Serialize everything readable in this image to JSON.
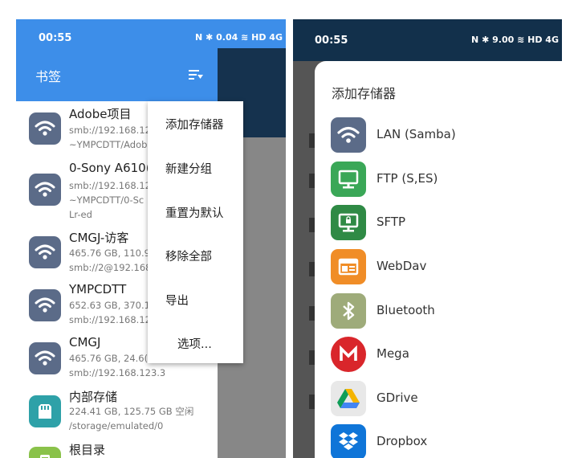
{
  "left": {
    "status": {
      "time": "00:55",
      "icons": "N ✱ 0.04 ≋ HD 4G"
    },
    "appbar": {
      "title": "书签",
      "sort_icon": "sort-filter-icon"
    },
    "bookmarks": [
      {
        "title": "Adobe项目",
        "lines": [
          "smb://192.168.12",
          "~YMPCDTT/Adob"
        ],
        "icon": "wifi-icon"
      },
      {
        "title": "0-Sony A610(",
        "lines": [
          "smb://192.168.12",
          "~YMPCDTT/0-Sc",
          "Lr-ed"
        ],
        "icon": "wifi-icon"
      },
      {
        "title": "CMGJ-访客",
        "lines": [
          "465.76 GB, 110.9",
          "smb://2@192.168"
        ],
        "icon": "wifi-icon"
      },
      {
        "title": "YMPCDTT",
        "lines": [
          "652.63 GB, 370.1",
          "smb://192.168.12"
        ],
        "icon": "wifi-icon"
      },
      {
        "title": "CMGJ",
        "lines": [
          "465.76 GB, 24.6(",
          "smb://192.168.123.3"
        ],
        "icon": "wifi-icon"
      },
      {
        "title": "内部存储",
        "lines": [
          "224.41 GB, 125.75 GB 空闲",
          "/storage/emulated/0"
        ],
        "icon": "sd-card-icon"
      },
      {
        "title": "根目录",
        "lines": [],
        "icon": "phone-icon"
      }
    ],
    "menu": [
      "添加存储器",
      "新建分组",
      "重置为默认",
      "移除全部",
      "导出",
      "选项..."
    ]
  },
  "right": {
    "status": {
      "time": "00:55",
      "icons": "N ✱ 9.00 ≋ HD 4G"
    },
    "sheet_title": "添加存储器",
    "options": [
      {
        "label": "LAN (Samba)",
        "icon": "wifi-icon",
        "color": "#5b6b88"
      },
      {
        "label": "FTP (S,ES)",
        "icon": "monitor-icon",
        "color": "#3aa757"
      },
      {
        "label": "SFTP",
        "icon": "secure-monitor-icon",
        "color": "#2f8a45"
      },
      {
        "label": "WebDav",
        "icon": "web-window-icon",
        "color": "#f08d27"
      },
      {
        "label": "Bluetooth",
        "icon": "bluetooth-icon",
        "color": "#9eab7a"
      },
      {
        "label": "Mega",
        "icon": "mega-logo-icon",
        "color": "#d9262b"
      },
      {
        "label": "GDrive",
        "icon": "google-drive-icon",
        "color": "#e8e8e8"
      },
      {
        "label": "Dropbox",
        "icon": "dropbox-icon",
        "color": "#0f75d8"
      }
    ]
  }
}
